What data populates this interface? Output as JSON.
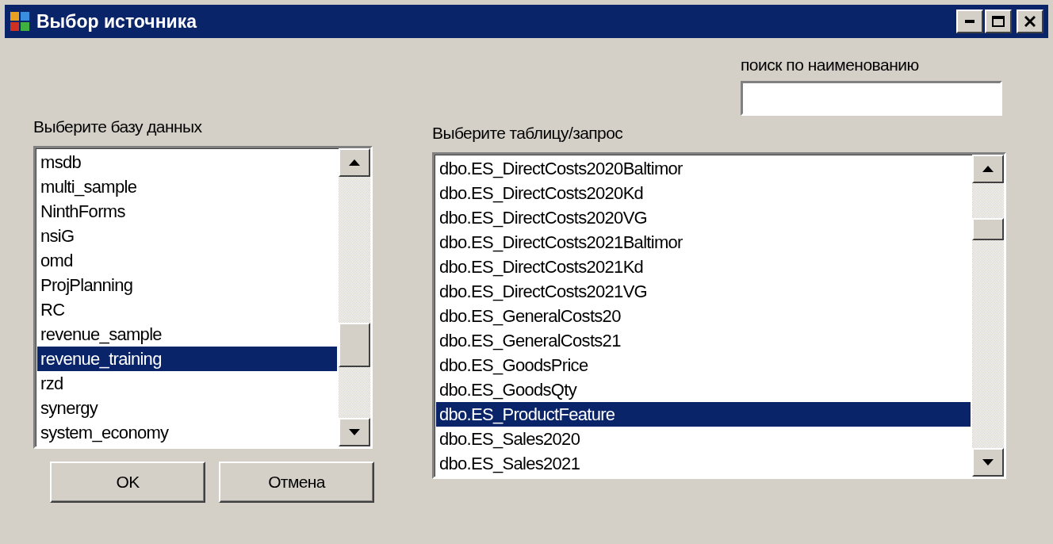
{
  "window": {
    "title": "Выбор источника"
  },
  "search": {
    "label": "поиск по наименованию"
  },
  "database_list": {
    "label": "Выберите базу данных",
    "items": [
      {
        "text": "msdb",
        "selected": false
      },
      {
        "text": "multi_sample",
        "selected": false
      },
      {
        "text": "NinthForms",
        "selected": false
      },
      {
        "text": "nsiG",
        "selected": false
      },
      {
        "text": "omd",
        "selected": false
      },
      {
        "text": "ProjPlanning",
        "selected": false
      },
      {
        "text": "RC",
        "selected": false
      },
      {
        "text": "revenue_sample",
        "selected": false
      },
      {
        "text": "revenue_training",
        "selected": true
      },
      {
        "text": "rzd",
        "selected": false
      },
      {
        "text": "synergy",
        "selected": false
      },
      {
        "text": "system_economy",
        "selected": false
      }
    ]
  },
  "table_list": {
    "label": "Выберите таблицу/запрос",
    "items": [
      {
        "text": "dbo.ES_DirectCosts2020Baltimor",
        "selected": false
      },
      {
        "text": "dbo.ES_DirectCosts2020Kd",
        "selected": false
      },
      {
        "text": "dbo.ES_DirectCosts2020VG",
        "selected": false
      },
      {
        "text": "dbo.ES_DirectCosts2021Baltimor",
        "selected": false
      },
      {
        "text": "dbo.ES_DirectCosts2021Kd",
        "selected": false
      },
      {
        "text": "dbo.ES_DirectCosts2021VG",
        "selected": false
      },
      {
        "text": "dbo.ES_GeneralCosts20",
        "selected": false
      },
      {
        "text": "dbo.ES_GeneralCosts21",
        "selected": false
      },
      {
        "text": "dbo.ES_GoodsPrice",
        "selected": false
      },
      {
        "text": "dbo.ES_GoodsQty",
        "selected": false
      },
      {
        "text": "dbo.ES_ProductFeature",
        "selected": true
      },
      {
        "text": "dbo.ES_Sales2020",
        "selected": false
      },
      {
        "text": "dbo.ES_Sales2021",
        "selected": false
      }
    ]
  },
  "buttons": [
    "OK",
    "Отмена"
  ]
}
